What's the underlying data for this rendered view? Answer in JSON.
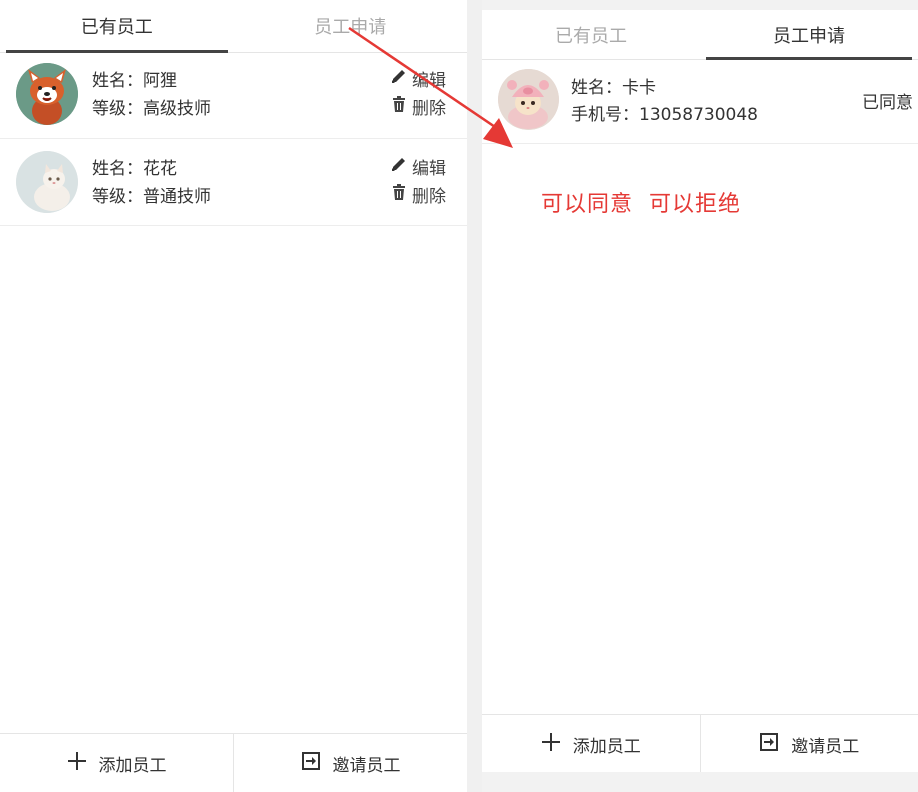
{
  "left": {
    "tabs": [
      {
        "label": "已有员工",
        "active": true
      },
      {
        "label": "员工申请",
        "active": false
      }
    ],
    "employees": [
      {
        "name_line": "姓名：阿狸",
        "level_line": "等级：高级技师",
        "edit_label": "编辑",
        "delete_label": "删除",
        "avatar": "red-panda-avatar"
      },
      {
        "name_line": "姓名：花花",
        "level_line": "等级：普通技师",
        "edit_label": "编辑",
        "delete_label": "删除",
        "avatar": "white-cat-avatar"
      }
    ],
    "bottom": {
      "add_label": "添加员工",
      "invite_label": "邀请员工"
    }
  },
  "right": {
    "tabs": [
      {
        "label": "已有员工",
        "active": false
      },
      {
        "label": "员工申请",
        "active": true
      }
    ],
    "applications": [
      {
        "name_line": "姓名：卡卡",
        "phone_line": "手机号：13058730048",
        "status": "已同意",
        "avatar": "pink-hat-cat-avatar"
      }
    ],
    "annotation": "可以同意  可以拒绝",
    "bottom": {
      "add_label": "添加员工",
      "invite_label": "邀请员工"
    }
  },
  "colors": {
    "annotation": "#e53935",
    "arrow": "#e53935",
    "active_tab_underline": "#444444"
  },
  "icons": [
    "pencil-icon",
    "trash-icon",
    "plus-icon",
    "invite-icon",
    "arrow-annotation"
  ]
}
